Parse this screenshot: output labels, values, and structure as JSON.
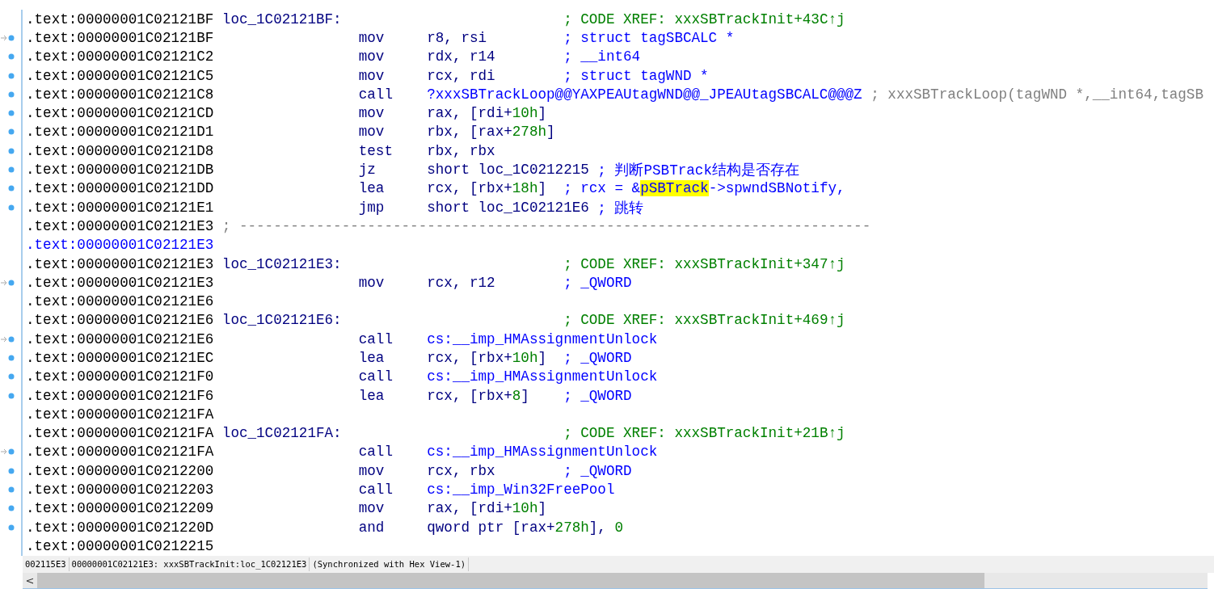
{
  "listing": [
    {
      "kind": "label",
      "address": ".text:00000001C02121BF",
      "current": false,
      "dot": false,
      "arrow": false,
      "label": "loc_1C02121BF:",
      "comment": [
        {
          "text": "; CODE XREF: xxxSBTrackInit+43C↑j",
          "kind": "xref"
        }
      ]
    },
    {
      "kind": "insn",
      "address": ".text:00000001C02121BF",
      "current": false,
      "dot": true,
      "arrow": true,
      "mnemonic": "mov",
      "operands": [
        {
          "text": "r8, rsi",
          "kind": "reg"
        }
      ],
      "comment": [
        {
          "text": "; struct tagSBCALC *",
          "kind": "user"
        }
      ]
    },
    {
      "kind": "insn",
      "address": ".text:00000001C02121C2",
      "current": false,
      "dot": true,
      "arrow": false,
      "mnemonic": "mov",
      "operands": [
        {
          "text": "rdx, r14",
          "kind": "reg"
        }
      ],
      "comment": [
        {
          "text": "; __int64",
          "kind": "user"
        }
      ]
    },
    {
      "kind": "insn",
      "address": ".text:00000001C02121C5",
      "current": false,
      "dot": true,
      "arrow": false,
      "mnemonic": "mov",
      "operands": [
        {
          "text": "rcx, rdi",
          "kind": "reg"
        }
      ],
      "comment": [
        {
          "text": "; struct tagWND *",
          "kind": "user"
        }
      ]
    },
    {
      "kind": "insn",
      "address": ".text:00000001C02121C8",
      "current": false,
      "dot": true,
      "arrow": false,
      "mnemonic": "call",
      "operands": [
        {
          "text": "?xxxSBTrackLoop@@YAXPEAUtagWND@@_JPEAUtagSBCALC@@@Z",
          "kind": "name"
        }
      ],
      "comment": [
        {
          "text": "; xxxSBTrackLoop(tagWND *,__int64,tagSB",
          "kind": "auto"
        }
      ]
    },
    {
      "kind": "insn",
      "address": ".text:00000001C02121CD",
      "current": false,
      "dot": true,
      "arrow": false,
      "mnemonic": "mov",
      "operands": [
        {
          "text": "rax, [rdi+",
          "kind": "reg"
        },
        {
          "text": "10h",
          "kind": "num"
        },
        {
          "text": "]",
          "kind": "reg"
        }
      ]
    },
    {
      "kind": "insn",
      "address": ".text:00000001C02121D1",
      "current": false,
      "dot": true,
      "arrow": false,
      "mnemonic": "mov",
      "operands": [
        {
          "text": "rbx, [rax+",
          "kind": "reg"
        },
        {
          "text": "278h",
          "kind": "num"
        },
        {
          "text": "]",
          "kind": "reg"
        }
      ]
    },
    {
      "kind": "insn",
      "address": ".text:00000001C02121D8",
      "current": false,
      "dot": true,
      "arrow": false,
      "mnemonic": "test",
      "operands": [
        {
          "text": "rbx, rbx",
          "kind": "reg"
        }
      ]
    },
    {
      "kind": "insn",
      "address": ".text:00000001C02121DB",
      "current": false,
      "dot": true,
      "arrow": false,
      "mnemonic": "jz",
      "operands": [
        {
          "text": "short loc_1C0212215",
          "kind": "reg"
        }
      ],
      "comment": [
        {
          "text": "; 判断PSBTrack结构是否存在",
          "kind": "user"
        }
      ]
    },
    {
      "kind": "insn",
      "address": ".text:00000001C02121DD",
      "current": false,
      "dot": true,
      "arrow": false,
      "mnemonic": "lea",
      "operands": [
        {
          "text": "rcx, [rbx+",
          "kind": "reg"
        },
        {
          "text": "18h",
          "kind": "num"
        },
        {
          "text": "]",
          "kind": "reg"
        }
      ],
      "comment": [
        {
          "text": "; rcx = &",
          "kind": "user"
        },
        {
          "text": "pSBTrack",
          "kind": "highlight"
        },
        {
          "text": "->spwndSBNotify,",
          "kind": "user"
        }
      ]
    },
    {
      "kind": "insn",
      "address": ".text:00000001C02121E1",
      "current": false,
      "dot": true,
      "arrow": false,
      "mnemonic": "jmp",
      "operands": [
        {
          "text": "short loc_1C02121E6",
          "kind": "reg"
        }
      ],
      "comment": [
        {
          "text": "; 跳转",
          "kind": "user"
        }
      ]
    },
    {
      "kind": "separator",
      "address": ".text:00000001C02121E3",
      "current": false,
      "dot": false,
      "arrow": false,
      "comment": [
        {
          "text": "; --------------------------------------------------------------------------",
          "kind": "auto"
        }
      ]
    },
    {
      "kind": "blank",
      "address": ".text:00000001C02121E3",
      "current": true,
      "dot": false,
      "arrow": false
    },
    {
      "kind": "label",
      "address": ".text:00000001C02121E3",
      "current": false,
      "dot": false,
      "arrow": false,
      "label": "loc_1C02121E3:",
      "comment": [
        {
          "text": "; CODE XREF: xxxSBTrackInit+347↑j",
          "kind": "xref"
        }
      ]
    },
    {
      "kind": "insn",
      "address": ".text:00000001C02121E3",
      "current": false,
      "dot": true,
      "arrow": true,
      "mnemonic": "mov",
      "operands": [
        {
          "text": "rcx, r12",
          "kind": "reg"
        }
      ],
      "comment": [
        {
          "text": "; _QWORD",
          "kind": "user"
        }
      ]
    },
    {
      "kind": "blank",
      "address": ".text:00000001C02121E6",
      "current": false,
      "dot": false,
      "arrow": false
    },
    {
      "kind": "label",
      "address": ".text:00000001C02121E6",
      "current": false,
      "dot": false,
      "arrow": false,
      "label": "loc_1C02121E6:",
      "comment": [
        {
          "text": "; CODE XREF: xxxSBTrackInit+469↑j",
          "kind": "xref"
        }
      ]
    },
    {
      "kind": "insn",
      "address": ".text:00000001C02121E6",
      "current": false,
      "dot": true,
      "arrow": true,
      "mnemonic": "call",
      "operands": [
        {
          "text": "cs:__imp_HMAssignmentUnlock",
          "kind": "name"
        }
      ]
    },
    {
      "kind": "insn",
      "address": ".text:00000001C02121EC",
      "current": false,
      "dot": true,
      "arrow": false,
      "mnemonic": "lea",
      "operands": [
        {
          "text": "rcx, [rbx+",
          "kind": "reg"
        },
        {
          "text": "10h",
          "kind": "num"
        },
        {
          "text": "]",
          "kind": "reg"
        }
      ],
      "comment": [
        {
          "text": "; _QWORD",
          "kind": "user"
        }
      ]
    },
    {
      "kind": "insn",
      "address": ".text:00000001C02121F0",
      "current": false,
      "dot": true,
      "arrow": false,
      "mnemonic": "call",
      "operands": [
        {
          "text": "cs:__imp_HMAssignmentUnlock",
          "kind": "name"
        }
      ]
    },
    {
      "kind": "insn",
      "address": ".text:00000001C02121F6",
      "current": false,
      "dot": true,
      "arrow": false,
      "mnemonic": "lea",
      "operands": [
        {
          "text": "rcx, [rbx+",
          "kind": "reg"
        },
        {
          "text": "8",
          "kind": "num"
        },
        {
          "text": "]",
          "kind": "reg"
        }
      ],
      "comment": [
        {
          "text": "; _QWORD",
          "kind": "user"
        }
      ]
    },
    {
      "kind": "blank",
      "address": ".text:00000001C02121FA",
      "current": false,
      "dot": false,
      "arrow": false
    },
    {
      "kind": "label",
      "address": ".text:00000001C02121FA",
      "current": false,
      "dot": false,
      "arrow": false,
      "label": "loc_1C02121FA:",
      "comment": [
        {
          "text": "; CODE XREF: xxxSBTrackInit+21B↑j",
          "kind": "xref"
        }
      ]
    },
    {
      "kind": "insn",
      "address": ".text:00000001C02121FA",
      "current": false,
      "dot": true,
      "arrow": true,
      "mnemonic": "call",
      "operands": [
        {
          "text": "cs:__imp_HMAssignmentUnlock",
          "kind": "name"
        }
      ]
    },
    {
      "kind": "insn",
      "address": ".text:00000001C0212200",
      "current": false,
      "dot": true,
      "arrow": false,
      "mnemonic": "mov",
      "operands": [
        {
          "text": "rcx, rbx",
          "kind": "reg"
        }
      ],
      "comment": [
        {
          "text": "; _QWORD",
          "kind": "user"
        }
      ]
    },
    {
      "kind": "insn",
      "address": ".text:00000001C0212203",
      "current": false,
      "dot": true,
      "arrow": false,
      "mnemonic": "call",
      "operands": [
        {
          "text": "cs:__imp_Win32FreePool",
          "kind": "name"
        }
      ]
    },
    {
      "kind": "insn",
      "address": ".text:00000001C0212209",
      "current": false,
      "dot": true,
      "arrow": false,
      "mnemonic": "mov",
      "operands": [
        {
          "text": "rax, [rdi+",
          "kind": "reg"
        },
        {
          "text": "10h",
          "kind": "num"
        },
        {
          "text": "]",
          "kind": "reg"
        }
      ]
    },
    {
      "kind": "insn",
      "address": ".text:00000001C021220D",
      "current": false,
      "dot": true,
      "arrow": false,
      "mnemonic": "and",
      "operands": [
        {
          "text": "qword ptr [rax+",
          "kind": "reg"
        },
        {
          "text": "278h",
          "kind": "num"
        },
        {
          "text": "], ",
          "kind": "reg"
        },
        {
          "text": "0",
          "kind": "num"
        }
      ]
    },
    {
      "kind": "blank",
      "address": ".text:00000001C0212215",
      "current": false,
      "dot": false,
      "arrow": false
    }
  ],
  "status_bar": [
    "002115E3",
    "00000001C02121E3: xxxSBTrackInit:loc_1C02121E3",
    "(Synchronized with Hex View-1)"
  ],
  "scrollbar": {
    "left_button": "<"
  }
}
